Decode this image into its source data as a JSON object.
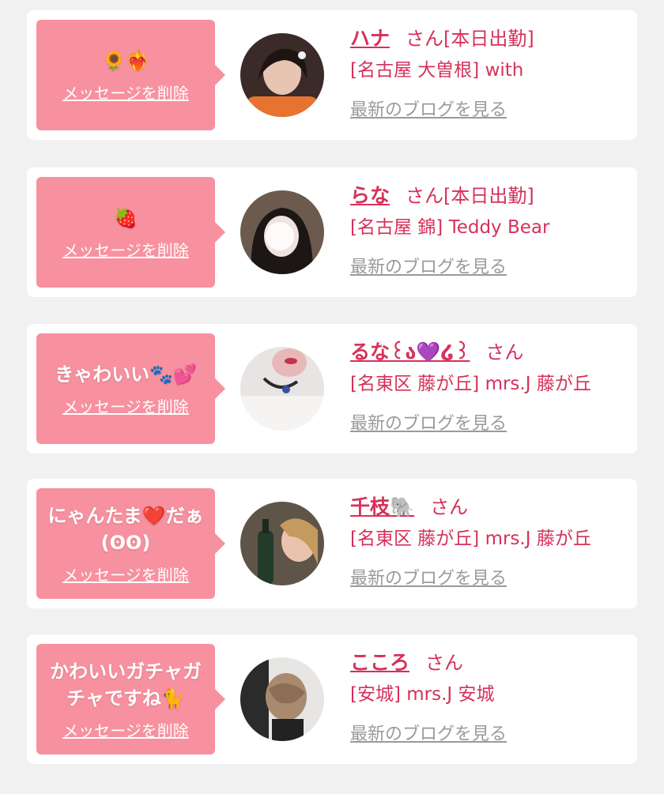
{
  "accent_color": "#d6315a",
  "bubble_color": "#f7919f",
  "items": [
    {
      "message": "🌻❤️‍🔥",
      "delete_label": "メッセージを削除",
      "name": "ハナ",
      "honorific": "さん[本日出勤]",
      "shop": "[名古屋 大曽根] with",
      "blog_label": "最新のブログを見る",
      "avatar_icon": "girl-photo-icon"
    },
    {
      "message": "🍓",
      "delete_label": "メッセージを削除",
      "name": "らな",
      "honorific": "さん[本日出勤]",
      "shop": "[名古屋 錦] Teddy Bear",
      "blog_label": "最新のブログを見る",
      "avatar_icon": "girl-photo-icon"
    },
    {
      "message": "きゃわいい🐾💕",
      "delete_label": "メッセージを削除",
      "name": "るな꒰ა💜໒꒱",
      "honorific": "さん",
      "shop": "[名東区 藤が丘] mrs.J 藤が丘",
      "blog_label": "最新のブログを見る",
      "avatar_icon": "girl-photo-icon"
    },
    {
      "message": "にゃんたま❤️だぁ(ʘʘ)",
      "delete_label": "メッセージを削除",
      "name": "千枝🐘",
      "honorific": "さん",
      "shop": "[名東区 藤が丘] mrs.J 藤が丘",
      "blog_label": "最新のブログを見る",
      "avatar_icon": "girl-photo-icon"
    },
    {
      "message": "かわいいガチャガチャですね🐈",
      "delete_label": "メッセージを削除",
      "name": "こころ",
      "honorific": "さん",
      "shop": "[安城] mrs.J 安城",
      "blog_label": "最新のブログを見る",
      "avatar_icon": "girl-photo-icon"
    }
  ]
}
